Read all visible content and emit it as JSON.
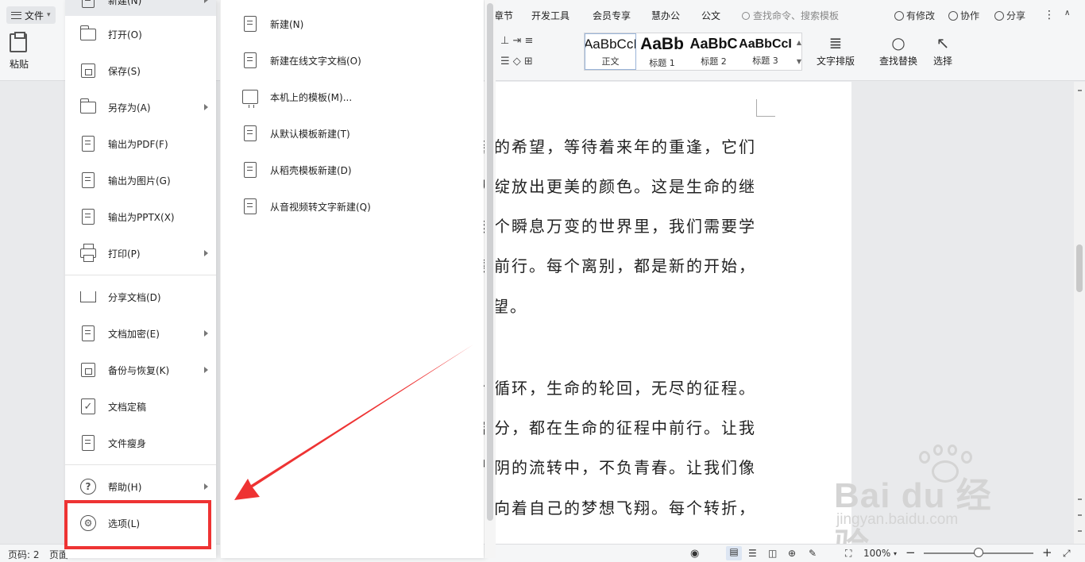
{
  "window": {
    "file_menu_button": "文件",
    "tabs": [
      "章节",
      "开发工具",
      "会员专享",
      "慧办公",
      "公文"
    ],
    "search_placeholder": "查找命令、搜索模板",
    "actions": [
      "有修改",
      "协作",
      "分享"
    ]
  },
  "ribbon": {
    "paste_label": "粘贴",
    "styles": [
      {
        "preview": "AaBbCcI",
        "name": "正文"
      },
      {
        "preview": "AaBb",
        "name": "标题 1"
      },
      {
        "preview": "AaBbC",
        "name": "标题 2"
      },
      {
        "preview": "AaBbCcI",
        "name": "标题 3"
      }
    ],
    "text_layout_label": "文字排版",
    "find_replace_label": "查找替换",
    "select_label": "选择"
  },
  "file_menu": {
    "items": [
      {
        "label": "新建(N)",
        "icon": "new-doc-icon",
        "arrow": true,
        "active": true
      },
      {
        "label": "打开(O)",
        "icon": "folder-icon",
        "arrow": false
      },
      {
        "label": "保存(S)",
        "icon": "save-icon",
        "arrow": false
      },
      {
        "label": "另存为(A)",
        "icon": "save-as-icon",
        "arrow": true
      },
      {
        "label": "输出为PDF(F)",
        "icon": "pdf-export-icon",
        "arrow": false
      },
      {
        "label": "输出为图片(G)",
        "icon": "image-export-icon",
        "arrow": false
      },
      {
        "label": "输出为PPTX(X)",
        "icon": "pptx-export-icon",
        "arrow": false
      },
      {
        "label": "打印(P)",
        "icon": "printer-icon",
        "arrow": true
      },
      {
        "label": "分享文档(D)",
        "icon": "share-icon",
        "arrow": false
      },
      {
        "label": "文档加密(E)",
        "icon": "encrypt-icon",
        "arrow": true
      },
      {
        "label": "备份与恢复(K)",
        "icon": "backup-icon",
        "arrow": true
      },
      {
        "label": "文档定稿",
        "icon": "finalize-icon",
        "arrow": false
      },
      {
        "label": "文件瘦身",
        "icon": "slim-icon",
        "arrow": false
      },
      {
        "label": "帮助(H)",
        "icon": "help-icon",
        "arrow": true
      },
      {
        "label": "选项(L)",
        "icon": "gear-icon",
        "arrow": false
      }
    ]
  },
  "new_submenu": {
    "items": [
      {
        "label": "新建(N)",
        "icon": "new-doc-icon"
      },
      {
        "label": "新建在线文字文档(O)",
        "icon": "new-online-doc-icon"
      },
      {
        "label": "本机上的模板(M)...",
        "icon": "local-template-icon"
      },
      {
        "label": "从默认模板新建(T)",
        "icon": "default-template-icon"
      },
      {
        "label": "从稻壳模板新建(D)",
        "icon": "docer-template-icon"
      },
      {
        "label": "从音视频转文字新建(Q)",
        "icon": "media-to-text-icon"
      }
    ]
  },
  "document": {
    "lines": [
      "新的希望，等待着来年的重逢，它们",
      "天绽放出更美的颜色。这是生命的继",
      "这个瞬息万变的世界里，我们需要学",
      "续前行。每个离别，都是新的开始，",
      "望。",
      "",
      "的循环，生命的轮回，无尽的征程。",
      "部分，都在生命的征程中前行。让我",
      "光阴的流转中，不负青春。让我们像",
      "行，向着自己的梦想飞翔。每个转折，"
    ]
  },
  "status": {
    "page": "页码: 2",
    "page2": "页面",
    "zoom": "100%"
  },
  "watermark": {
    "text": "Bai du 经验",
    "sub": "jingyan.baidu.com"
  },
  "colors": {
    "highlight": "#ee3333",
    "arrow": "#ee3333"
  }
}
